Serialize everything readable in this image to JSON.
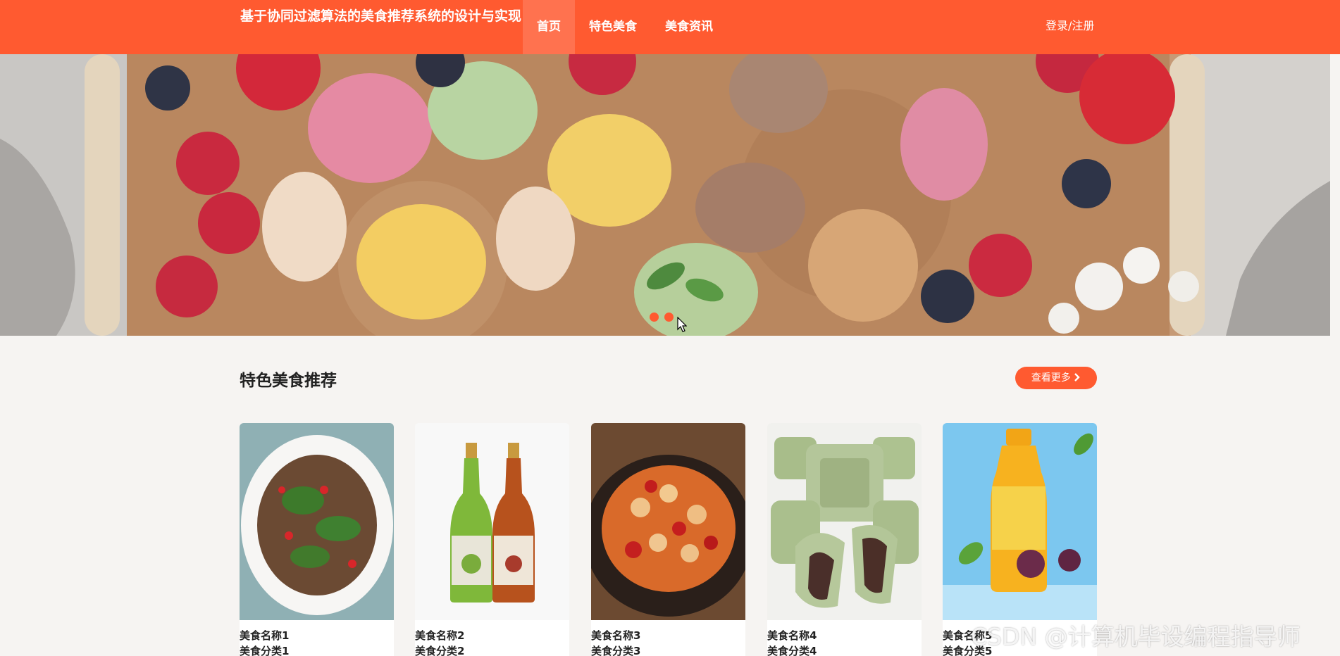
{
  "header": {
    "brand": "基于协同过滤算法的美食推荐系统的设计与实现",
    "nav": [
      {
        "label": "首页",
        "active": true
      },
      {
        "label": "特色美食",
        "active": false
      },
      {
        "label": "美食资讯",
        "active": false
      }
    ],
    "login_label": "登录/注册",
    "accent_color": "#ff5a30"
  },
  "banner": {
    "image_description_icon": "macaron-photo",
    "dots_count": 2
  },
  "featured": {
    "title": "特色美食推荐",
    "more_label": "查看更多",
    "more_icon": "chevron-right-icon",
    "items": [
      {
        "name": "美食名称1",
        "category": "美食分类1"
      },
      {
        "name": "美食名称2",
        "category": "美食分类2"
      },
      {
        "name": "美食名称3",
        "category": "美食分类3"
      },
      {
        "name": "美食名称4",
        "category": "美食分类4"
      },
      {
        "name": "美食名称5",
        "category": "美食分类5"
      }
    ]
  },
  "watermark": "CSDN @计算机毕设编程指导师"
}
